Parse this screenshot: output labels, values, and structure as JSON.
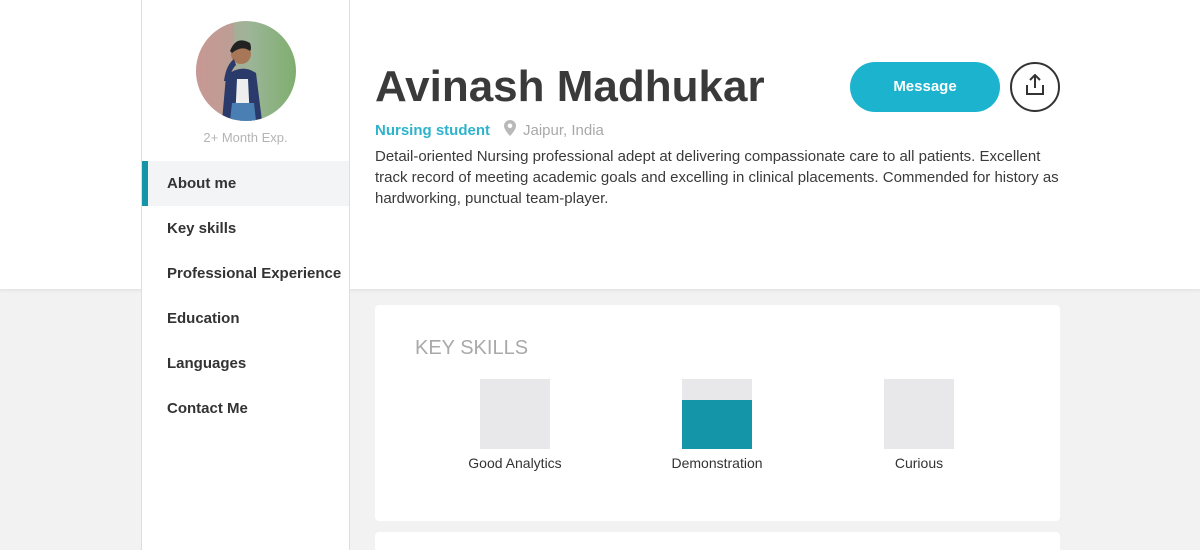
{
  "profile": {
    "name": "Avinash Madhukar",
    "role": "Nursing student",
    "location": "Jaipur, India",
    "experience": "2+ Month Exp.",
    "bio": "Detail-oriented Nursing professional adept at delivering compassionate care to all patients. Excellent track record of meeting academic goals and excelling in clinical placements. Commended for history as hardworking, punctual team-player."
  },
  "actions": {
    "message_label": "Message",
    "share_icon": "share-upload-icon"
  },
  "sidebar": {
    "items": [
      {
        "label": "About me",
        "active": true
      },
      {
        "label": "Key skills",
        "active": false
      },
      {
        "label": "Professional Experience",
        "active": false
      },
      {
        "label": "Education",
        "active": false
      },
      {
        "label": "Languages",
        "active": false
      },
      {
        "label": "Contact Me",
        "active": false
      }
    ]
  },
  "skills": {
    "title": "KEY SKILLS",
    "items": [
      {
        "label": "Good Analytics",
        "level": 0.0
      },
      {
        "label": "Demonstration",
        "level": 0.7
      },
      {
        "label": "Curious",
        "level": 0.0
      }
    ]
  },
  "colors": {
    "accent": "#1cb3cf",
    "skill_fill": "#1596a8",
    "role_text": "#2fb3cc"
  }
}
